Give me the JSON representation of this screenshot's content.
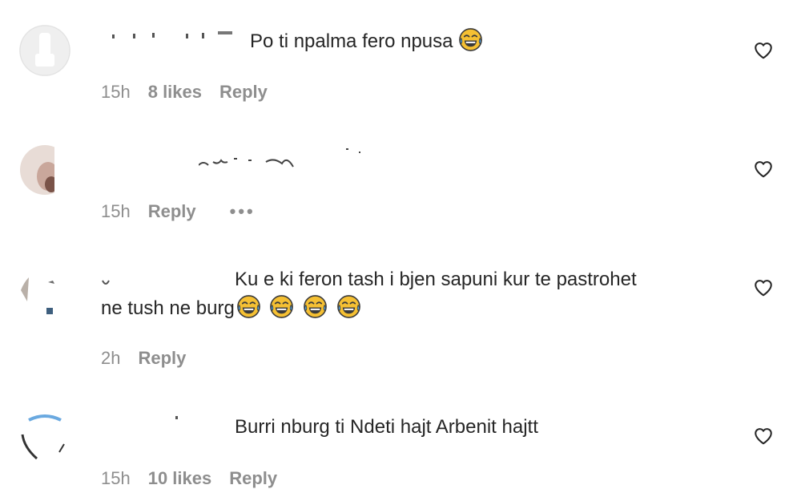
{
  "comments": [
    {
      "text": "Po ti npalma fero npusa",
      "emoji_count": 1,
      "time": "15h",
      "likes": "8 likes",
      "reply": "Reply"
    },
    {
      "text": "",
      "time": "15h",
      "reply": "Reply",
      "more": "•••"
    },
    {
      "text_line1": "Ku e ki feron tash i bjen sapuni kur te pastrohet",
      "text_line2": "ne tush ne burg",
      "emoji_count": 4,
      "time": "2h",
      "reply": "Reply"
    },
    {
      "text": "Burri nburg ti Ndeti hajt Arbenit hajtt",
      "time": "15h",
      "likes": "10 likes",
      "reply": "Reply"
    }
  ],
  "icons": {
    "like": "heart-outline-icon",
    "emoji": "face-with-tears-of-joy-icon"
  },
  "colors": {
    "text": "#262626",
    "meta": "#8e8e8e",
    "emoji_face": "#f5c033",
    "emoji_tears": "#4fa3e0"
  }
}
